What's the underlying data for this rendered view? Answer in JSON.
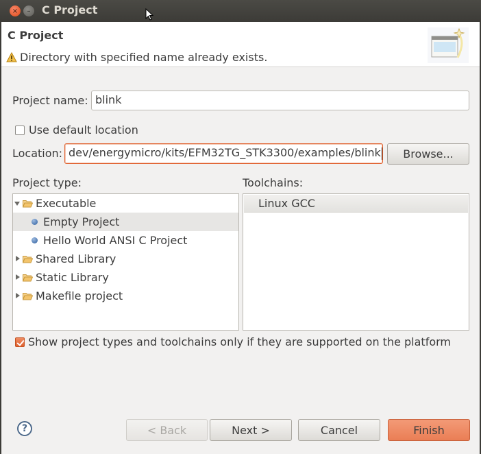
{
  "window": {
    "title": "C Project",
    "close_glyph": "×",
    "minimize_glyph": "–"
  },
  "header": {
    "title": "C Project",
    "message": "Directory with specified name already exists.",
    "message_icon": "warning-icon",
    "banner_icon": "new-wizard-icon"
  },
  "form": {
    "project_name_label": "Project name:",
    "project_name_value": "blink",
    "use_default_location_label": "Use default location",
    "use_default_location_checked": false,
    "location_label": "Location:",
    "location_value": "dev/energymicro/kits/EFM32TG_STK3300/examples/blink",
    "browse_label": "Browse..."
  },
  "project_type": {
    "label": "Project type:",
    "items": [
      {
        "label": "Executable",
        "kind": "folder",
        "expanded": true,
        "level": 0
      },
      {
        "label": "Empty Project",
        "kind": "leaf",
        "selected": true,
        "level": 1
      },
      {
        "label": "Hello World ANSI C Project",
        "kind": "leaf",
        "level": 1
      },
      {
        "label": "Shared Library",
        "kind": "folder",
        "expanded": false,
        "level": 0
      },
      {
        "label": "Static Library",
        "kind": "folder",
        "expanded": false,
        "level": 0
      },
      {
        "label": "Makefile project",
        "kind": "folder",
        "expanded": false,
        "level": 0
      }
    ]
  },
  "toolchains": {
    "label": "Toolchains:",
    "items": [
      "Linux GCC"
    ]
  },
  "filter": {
    "label": "Show project types and toolchains only if they are supported on the platform",
    "checked": true
  },
  "buttons": {
    "help_glyph": "?",
    "back": "< Back",
    "next": "Next >",
    "cancel": "Cancel",
    "finish": "Finish"
  },
  "colors": {
    "accent": "#e0612f",
    "primary_button": "#ea7e55",
    "titlebar": "#3c3b37"
  }
}
